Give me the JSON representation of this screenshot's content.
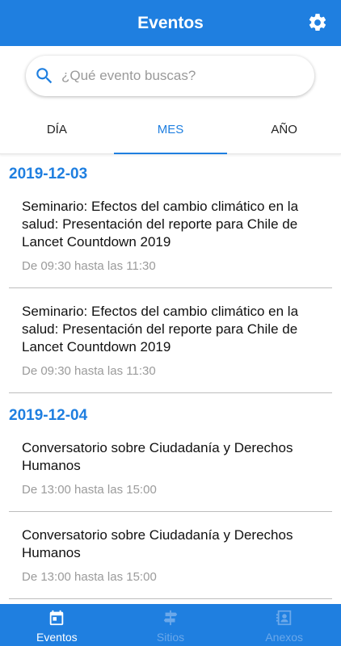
{
  "header": {
    "title": "Eventos",
    "settings_icon": "gear-icon"
  },
  "search": {
    "placeholder": "¿Qué evento buscas?",
    "value": "",
    "icon": "search-icon"
  },
  "tabs": [
    {
      "label": "DÍA",
      "active": false
    },
    {
      "label": "MES",
      "active": true
    },
    {
      "label": "AÑO",
      "active": false
    }
  ],
  "groups": [
    {
      "date": "2019-12-03",
      "events": [
        {
          "title": "Seminario: Efectos del cambio climático en la salud: Presentación del reporte para Chile de Lancet Countdown 2019",
          "time": "De 09:30 hasta las 11:30"
        },
        {
          "title": "Seminario: Efectos del cambio climático en la salud: Presentación del reporte para Chile de Lancet Countdown 2019",
          "time": "De 09:30 hasta las 11:30"
        }
      ]
    },
    {
      "date": "2019-12-04",
      "events": [
        {
          "title": "Conversatorio sobre Ciudadanía y Derechos Humanos",
          "time": "De 13:00 hasta las 15:00"
        },
        {
          "title": "Conversatorio sobre Ciudadanía y Derechos Humanos",
          "time": "De 13:00 hasta las 15:00"
        }
      ]
    }
  ],
  "bottom_nav": [
    {
      "label": "Eventos",
      "icon": "calendar-icon",
      "active": true
    },
    {
      "label": "Sitios",
      "icon": "signpost-icon",
      "active": false
    },
    {
      "label": "Anexos",
      "icon": "contact-card-icon",
      "active": false
    }
  ],
  "colors": {
    "primary": "#1f7fe0",
    "secondary_text": "#9b9b9b",
    "inactive_nav": "#6ba8ea"
  }
}
